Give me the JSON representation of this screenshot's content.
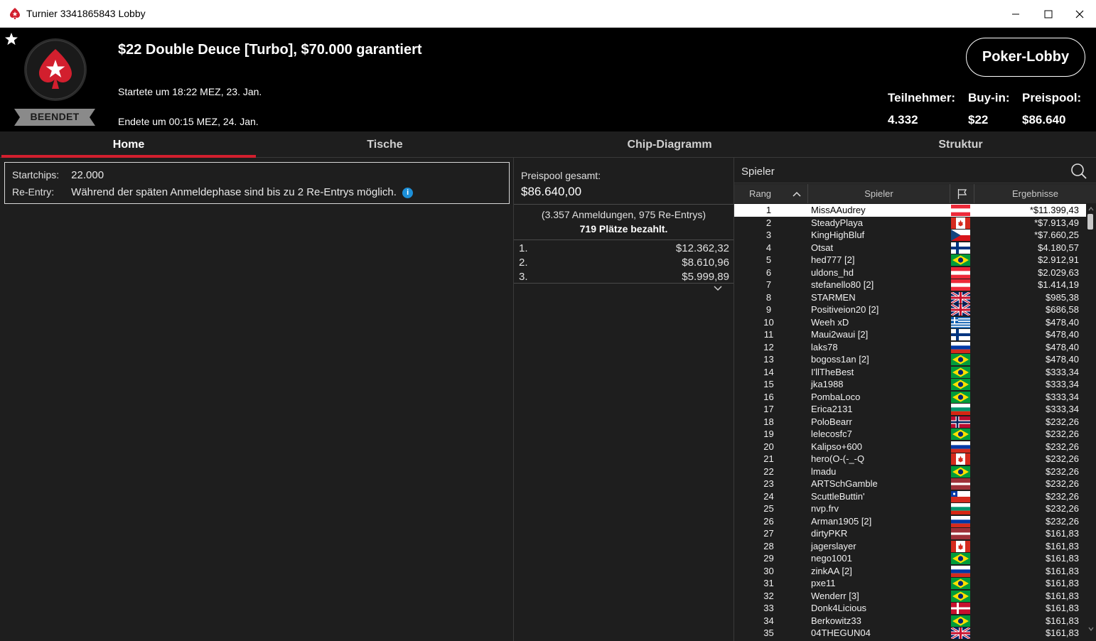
{
  "window": {
    "title": "Turnier 3341865843 Lobby"
  },
  "header": {
    "tournament_name": "$22 Double Deuce [Turbo], $70.000 garantiert",
    "started": "Startete um 18:22 MEZ, 23. Jan.",
    "ended": "Endete um 00:15 MEZ, 24. Jan.",
    "status": "BEENDET",
    "lobby_button": "Poker-Lobby",
    "stats": [
      {
        "label": "Teilnehmer:",
        "value": "4.332"
      },
      {
        "label": "Buy-in:",
        "value": "$22"
      },
      {
        "label": "Preispool:",
        "value": "$86.640"
      }
    ],
    "accent_color": "#d21f2e"
  },
  "tabs": [
    {
      "label": "Home",
      "active": true
    },
    {
      "label": "Tische",
      "active": false
    },
    {
      "label": "Chip-Diagramm",
      "active": false
    },
    {
      "label": "Struktur",
      "active": false
    }
  ],
  "info": {
    "startchips_label": "Startchips:",
    "startchips_value": "22.000",
    "reentry_label": "Re-Entry:",
    "reentry_value": "Während der späten Anmeldephase sind bis zu 2 Re-Entrys möglich.",
    "info_icon": "i"
  },
  "prizes": {
    "total_label": "Preispool gesamt:",
    "total_value": "$86.640,00",
    "registrations": "(3.357 Anmeldungen, 975 Re-Entrys)",
    "paid_places": "719 Plätze bezahlt.",
    "rows": [
      {
        "place": "1.",
        "amount": "$12.362,32"
      },
      {
        "place": "2.",
        "amount": "$8.610,96"
      },
      {
        "place": "3.",
        "amount": "$5.999,89"
      }
    ]
  },
  "players": {
    "search_label": "Spieler",
    "columns": {
      "rank": "Rang",
      "player": "Spieler",
      "result": "Ergebnisse"
    },
    "rows": [
      {
        "rank": "1",
        "name": "MissAAudrey",
        "flag": "at",
        "result": "*$11.399,43"
      },
      {
        "rank": "2",
        "name": "SteadyPlaya",
        "flag": "ca",
        "result": "*$7.913,49"
      },
      {
        "rank": "3",
        "name": "KingHighBluf",
        "flag": "cz",
        "result": "*$7.660,25"
      },
      {
        "rank": "4",
        "name": "Otsat",
        "flag": "fi",
        "result": "$4.180,57"
      },
      {
        "rank": "5",
        "name": "hed777 [2]",
        "flag": "br",
        "result": "$2.912,91"
      },
      {
        "rank": "6",
        "name": "uldons_hd",
        "flag": "at",
        "result": "$2.029,63"
      },
      {
        "rank": "7",
        "name": "stefanello80 [2]",
        "flag": "at",
        "result": "$1.414,19"
      },
      {
        "rank": "8",
        "name": "STARMEN",
        "flag": "gb",
        "result": "$985,38"
      },
      {
        "rank": "9",
        "name": "Positiveion20 [2]",
        "flag": "gb",
        "result": "$686,58"
      },
      {
        "rank": "10",
        "name": "Weeh xD",
        "flag": "gr",
        "result": "$478,40"
      },
      {
        "rank": "11",
        "name": "Maui2waui [2]",
        "flag": "fi",
        "result": "$478,40"
      },
      {
        "rank": "12",
        "name": "laks78",
        "flag": "ru",
        "result": "$478,40"
      },
      {
        "rank": "13",
        "name": "bogoss1an [2]",
        "flag": "br",
        "result": "$478,40"
      },
      {
        "rank": "14",
        "name": "I'llTheBest",
        "flag": "br",
        "result": "$333,34"
      },
      {
        "rank": "15",
        "name": "jka1988",
        "flag": "br",
        "result": "$333,34"
      },
      {
        "rank": "16",
        "name": "PombaLoco",
        "flag": "br",
        "result": "$333,34"
      },
      {
        "rank": "17",
        "name": "Erica2131",
        "flag": "bg",
        "result": "$333,34"
      },
      {
        "rank": "18",
        "name": "PoloBearr",
        "flag": "no",
        "result": "$232,26"
      },
      {
        "rank": "19",
        "name": "lelecosfc7",
        "flag": "br",
        "result": "$232,26"
      },
      {
        "rank": "20",
        "name": "Kalipso+600",
        "flag": "ru",
        "result": "$232,26"
      },
      {
        "rank": "21",
        "name": "hero(O-(-_-Q",
        "flag": "ca",
        "result": "$232,26"
      },
      {
        "rank": "22",
        "name": "lmadu",
        "flag": "br",
        "result": "$232,26"
      },
      {
        "rank": "23",
        "name": "ARTSchGamble",
        "flag": "lv",
        "result": "$232,26"
      },
      {
        "rank": "24",
        "name": "ScuttleButtin'",
        "flag": "cl",
        "result": "$232,26"
      },
      {
        "rank": "25",
        "name": "nvp.frv",
        "flag": "bg",
        "result": "$232,26"
      },
      {
        "rank": "26",
        "name": "Arman1905 [2]",
        "flag": "ru",
        "result": "$232,26"
      },
      {
        "rank": "27",
        "name": "dirtyPKR",
        "flag": "lv",
        "result": "$161,83"
      },
      {
        "rank": "28",
        "name": "jagerslayer",
        "flag": "ca",
        "result": "$161,83"
      },
      {
        "rank": "29",
        "name": "nego1001",
        "flag": "br",
        "result": "$161,83"
      },
      {
        "rank": "30",
        "name": "zinkAA [2]",
        "flag": "ru",
        "result": "$161,83"
      },
      {
        "rank": "31",
        "name": "pxe11",
        "flag": "br",
        "result": "$161,83"
      },
      {
        "rank": "32",
        "name": "Wenderr [3]",
        "flag": "br",
        "result": "$161,83"
      },
      {
        "rank": "33",
        "name": "Donk4Licious",
        "flag": "dk",
        "result": "$161,83"
      },
      {
        "rank": "34",
        "name": "Berkowitz33",
        "flag": "br",
        "result": "$161,83"
      },
      {
        "rank": "35",
        "name": "04THEGUN04",
        "flag": "gb",
        "result": "$161,83"
      }
    ]
  }
}
